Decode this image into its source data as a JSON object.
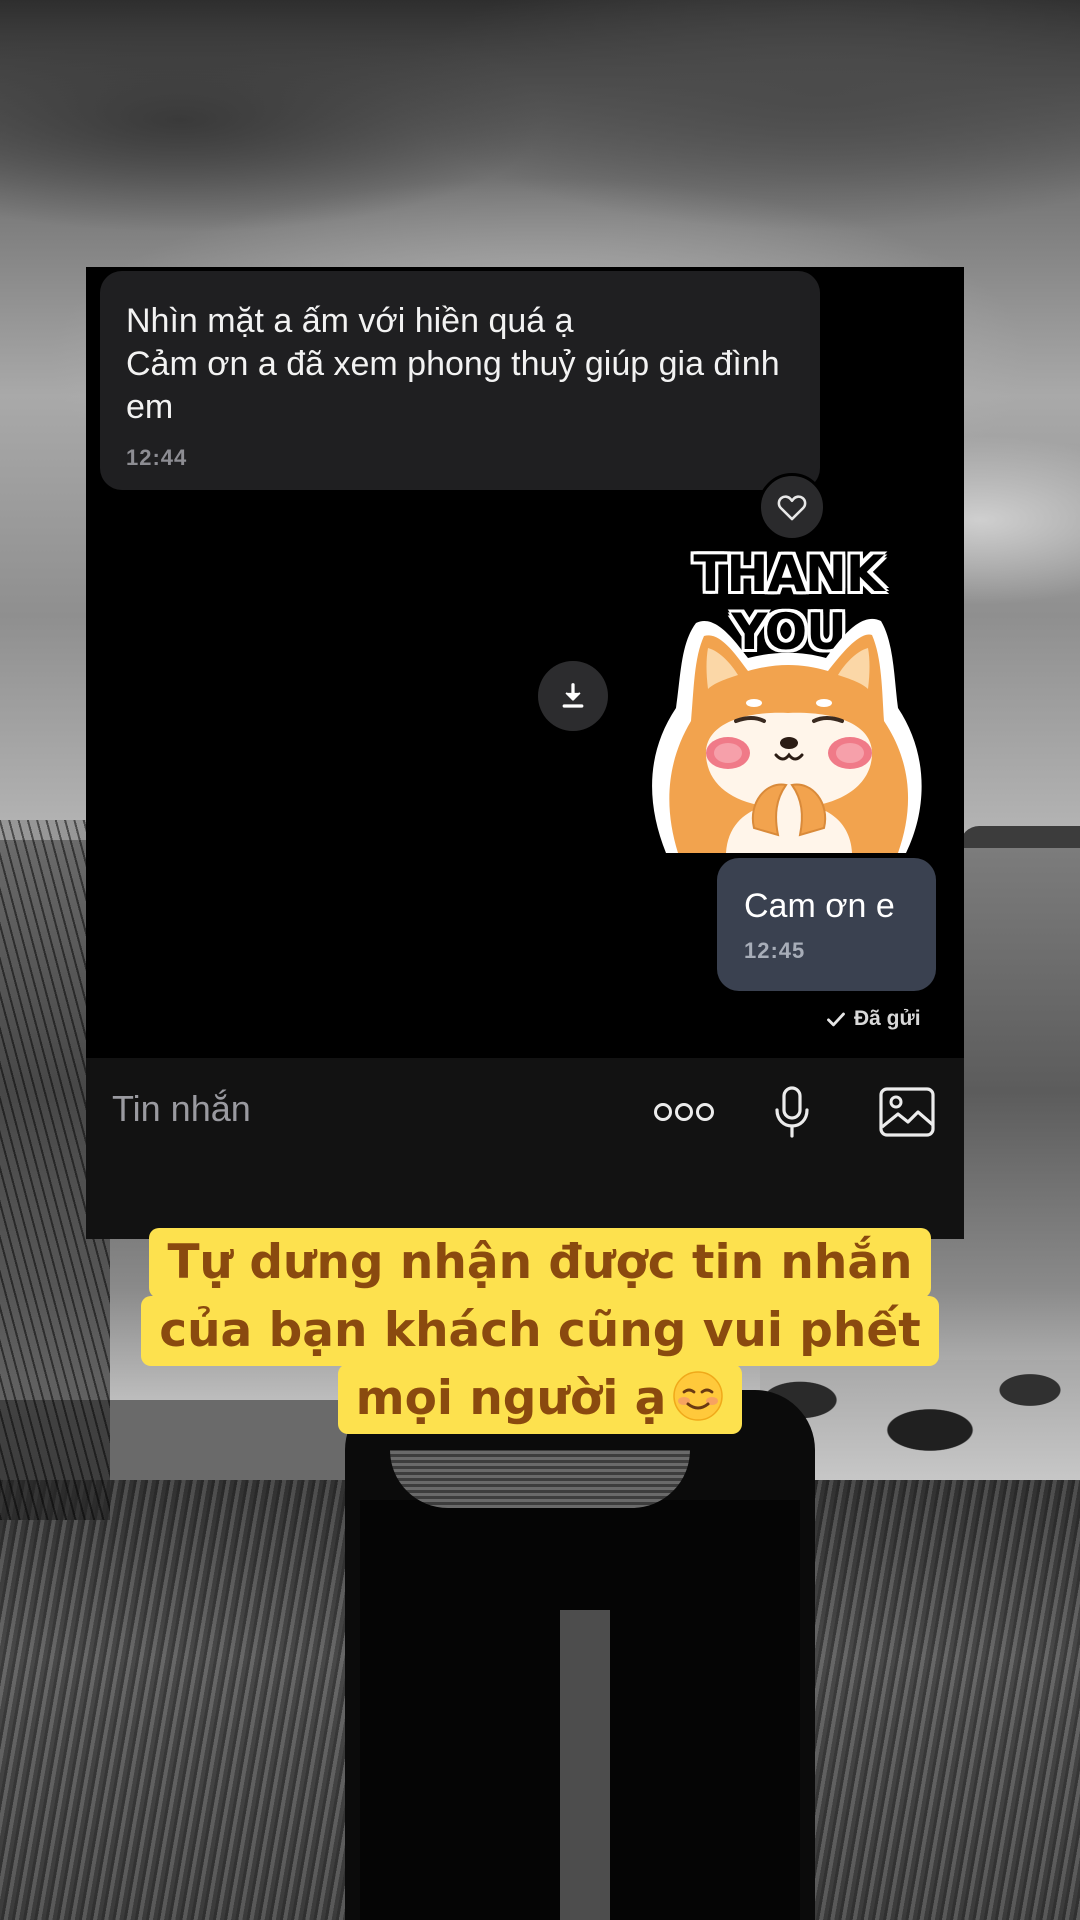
{
  "chat": {
    "incoming": {
      "text": "Nhìn mặt a ấm với hiền quá ạ\nCảm ơn a đã xem phong thuỷ giúp gia đình em",
      "time": "12:44"
    },
    "sticker": {
      "caption": "THANK YOU"
    },
    "outgoing": {
      "text": "Cam ơn e",
      "time": "12:45",
      "status": "Đã gửi"
    },
    "composer": {
      "placeholder": "Tin nhắn"
    },
    "icons": {
      "react": "heart-icon",
      "download": "download-icon",
      "more": "more-dots-icon",
      "mic": "microphone-icon",
      "image": "image-icon",
      "status": "check-icon"
    },
    "colors": {
      "chat_bg": "#000000",
      "incoming_bubble": "#1f1f21",
      "outgoing_bubble": "#3a4150",
      "composer_bg": "#121212"
    }
  },
  "caption": {
    "lines": [
      "Tự dưng nhận được tin nhắn",
      "của bạn khách cũng vui phết",
      "mọi người ạ"
    ],
    "emoji": "smiling-face-emoji",
    "bg_color": "#fde14e",
    "text_color": "#8a4a0f"
  }
}
